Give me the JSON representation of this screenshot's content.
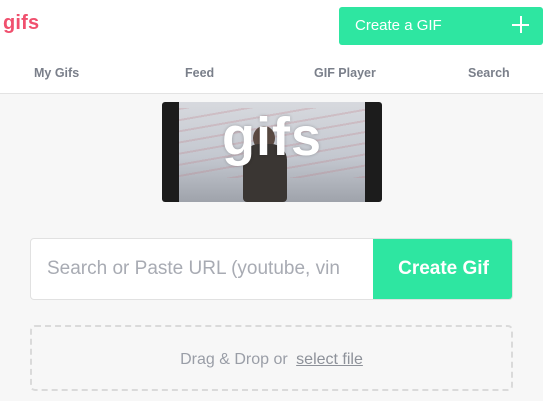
{
  "header": {
    "logo": "gifs",
    "create_button": {
      "label": "Create a GIF",
      "icon": "plus-icon"
    }
  },
  "nav": {
    "items": [
      {
        "label": "My Gifs"
      },
      {
        "label": "Feed"
      },
      {
        "label": "GIF Player"
      },
      {
        "label": "Search"
      }
    ]
  },
  "hero": {
    "text": "gifs"
  },
  "search": {
    "value": "",
    "placeholder": "Search or Paste URL (youtube, vin",
    "submit_label": "Create Gif"
  },
  "dropzone": {
    "text": "Drag & Drop or",
    "link_label": "select file"
  },
  "colors": {
    "accent": "#2ee6a1",
    "logo": "#f0506e",
    "background": "#f7f7f7"
  }
}
